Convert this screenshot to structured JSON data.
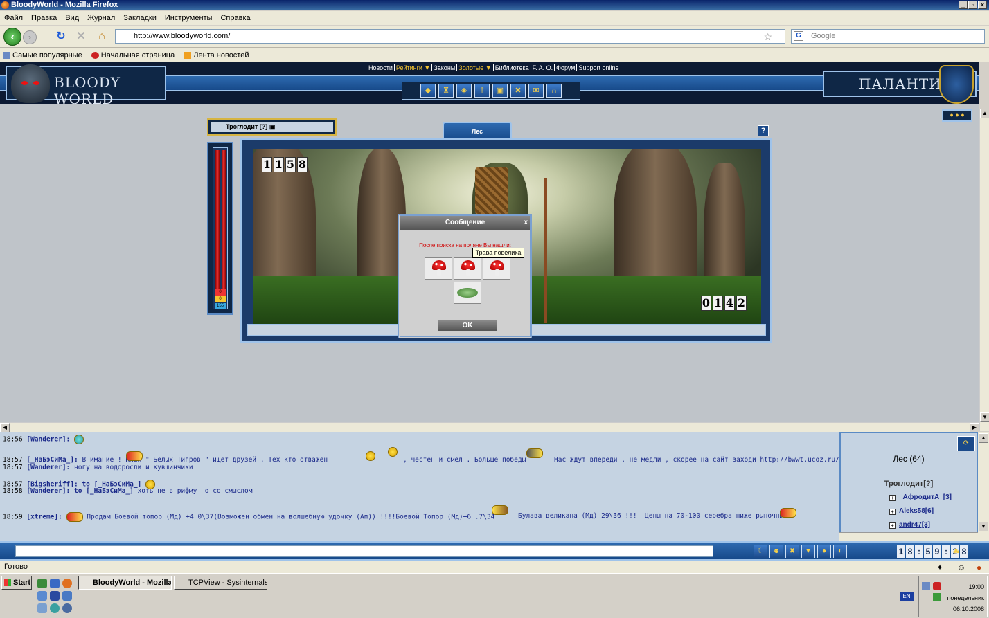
{
  "window": {
    "title": "BloodyWorld - Mozilla Firefox"
  },
  "menu": [
    "Файл",
    "Правка",
    "Вид",
    "Журнал",
    "Закладки",
    "Инструменты",
    "Справка"
  ],
  "nav": {
    "url": "http://www.bloodyworld.com/",
    "search_placeholder": "Google"
  },
  "bookmarks": [
    "Самые популярные",
    "Начальная страница",
    "Лента новостей"
  ],
  "site": {
    "top_menu": [
      "Новости",
      "Рейтинги ▼",
      "Законы",
      "Золотые ▼",
      "Библиотека",
      "F. A. Q.",
      "Форум",
      "Support online"
    ],
    "logo_text": "BLOODY WORLD",
    "clan_text": "ПАЛАНТИН",
    "player_name": "Троглодит [?]",
    "hp_values": [
      "0",
      "0",
      "155"
    ],
    "location_tab": "Лес",
    "help_label": "?",
    "counter_left": [
      "1",
      "1",
      "5",
      "8"
    ],
    "counter_right": [
      "0",
      "1",
      "4",
      "2"
    ]
  },
  "dialog": {
    "title": "Сообщение",
    "close": "x",
    "message": "После поиска на поляне Вы нашли:",
    "ok": "OK",
    "tooltip": "Трава повелика"
  },
  "chat": [
    {
      "time": "18:56",
      "name": "[Wanderer]:",
      "msg": ""
    },
    {
      "time": "18:57",
      "name": "[_НаБэСиМа_]:",
      "msg": "Внимание !      Клан \" Белых Тигров \" ищет друзей . Тех кто отважен",
      "msg2": ", честен и смел . Больше победы",
      "msg3": "Нас ждут впереди , не медли , скорее на сайт заходи http://bwwt.ucoz.ru/"
    },
    {
      "time": "18:57",
      "name": "[Wanderer]:",
      "msg": "ногу на водоросли и кувшинчики"
    },
    {
      "time": "18:57",
      "name": "[Bigsheriff]:",
      "to": "to",
      "toname": "[_НаБэСиМа_]",
      "msg": ""
    },
    {
      "time": "18:58",
      "name": "[Wanderer]:",
      "to": "to",
      "toname": "[_НаБэСиМа_]",
      "msg": "хоть не в рифму но со смыслом"
    },
    {
      "time": "18:59",
      "name": "[xtreme]:",
      "msg": "Продам Боевой топор (Мд) +4 0\\37(Возможен обмен на волшебную удочку (Ап)) !!!!Боевой Топор (Мд)+6 .7\\34",
      "msg2": "Булава великана (Мд) 29\\36 !!!! Цены на 70-100 серебра ниже рыночных"
    }
  ],
  "online": {
    "location": "Лес (64)",
    "me": "Троглодит[?]",
    "users": [
      "_АфродитА_[3]",
      "Aleks58[6]",
      "andr47[3]"
    ]
  },
  "clock": [
    "1",
    "8",
    ":",
    "5",
    "9",
    ":",
    "2",
    "8"
  ],
  "status": "Готово",
  "taskbar": {
    "start": "Start",
    "buttons": [
      "BloodyWorld - Mozilla...",
      "TCPView - Sysinternals: ..."
    ],
    "lang": "EN",
    "time": "19:00",
    "day": "понедельник",
    "date": "06.10.2008"
  }
}
